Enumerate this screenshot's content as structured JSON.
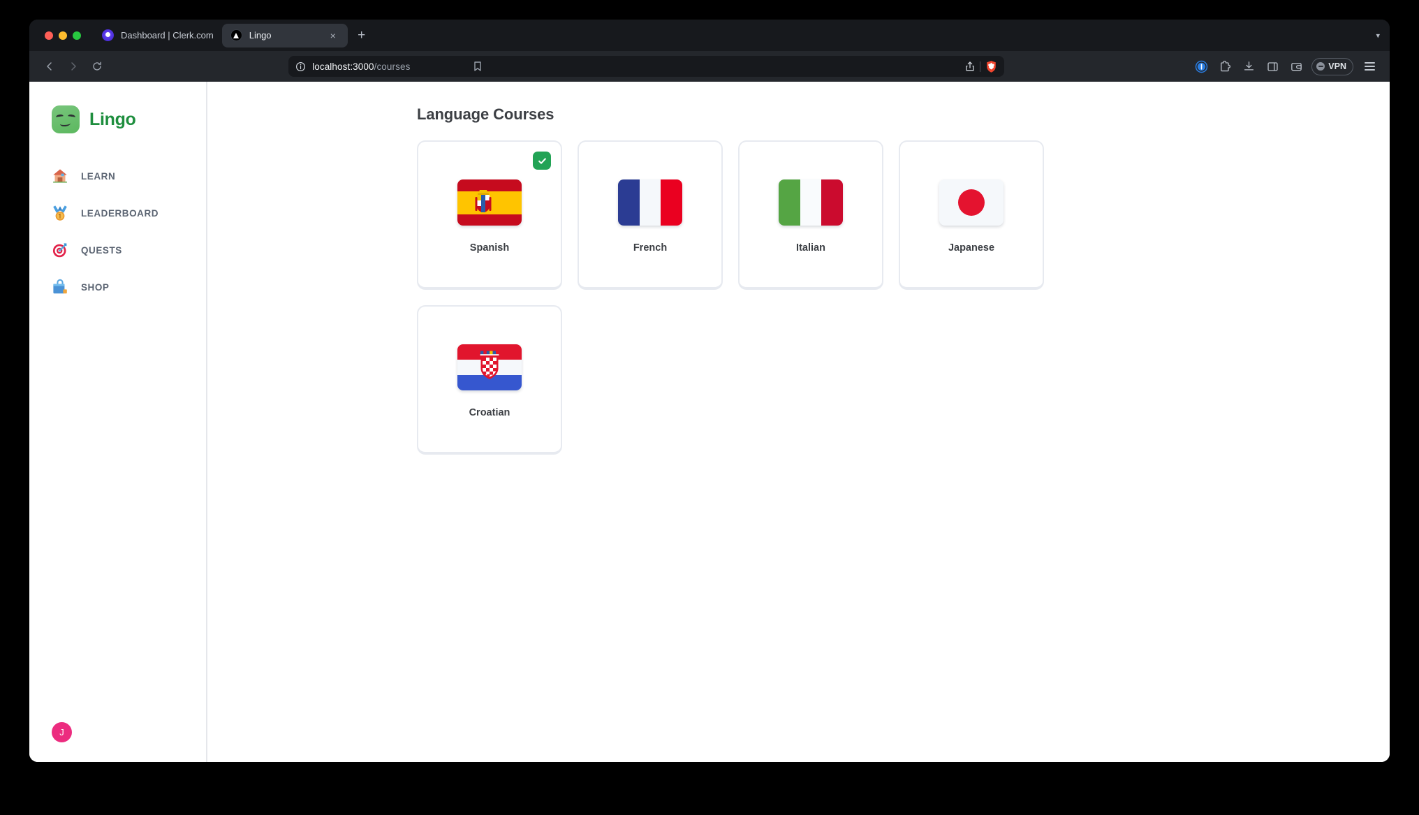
{
  "browser": {
    "name": "Brave",
    "tabs": [
      {
        "title": "Dashboard | Clerk.com",
        "favicon": "clerk-icon",
        "active": false
      },
      {
        "title": "Lingo",
        "favicon": "nextjs-triangle-icon",
        "active": true
      }
    ],
    "new_tab_label": "+",
    "tab_close_label": "×",
    "tabstrip_chevron": "▾",
    "url": {
      "host": "localhost:3000",
      "path": "/courses",
      "full": "localhost:3000/courses"
    },
    "toolbar": {
      "back_label": "back-icon",
      "forward_label": "forward-icon",
      "reload_label": "reload-icon",
      "bookmark_label": "bookmark-icon",
      "share_label": "share-icon",
      "shield_label": "brave-shields-icon",
      "actions": [
        {
          "name": "1password-extension-icon",
          "label": "1"
        },
        {
          "name": "extensions-icon",
          "label": ""
        },
        {
          "name": "downloads-icon",
          "label": ""
        },
        {
          "name": "sidebar-toggle-icon",
          "label": ""
        },
        {
          "name": "brave-wallet-icon",
          "label": ""
        }
      ],
      "vpn_label": "VPN",
      "menu_label": "menu-icon"
    }
  },
  "app": {
    "brand": {
      "name": "Lingo",
      "accent_color": "#1e8e3e",
      "mark": "lingo-mascot-icon"
    },
    "sidebar": {
      "items": [
        {
          "label": "LEARN",
          "icon": "house-icon"
        },
        {
          "label": "LEADERBOARD",
          "icon": "medal-icon"
        },
        {
          "label": "QUESTS",
          "icon": "target-dart-icon"
        },
        {
          "label": "SHOP",
          "icon": "shopping-bag-icon"
        }
      ],
      "user": {
        "initial": "J",
        "color": "#ec2c7f"
      }
    },
    "main": {
      "title": "Language Courses",
      "courses": [
        {
          "name": "Spanish",
          "flag": "flag-es",
          "selected": true
        },
        {
          "name": "French",
          "flag": "flag-fr",
          "selected": false
        },
        {
          "name": "Italian",
          "flag": "flag-it",
          "selected": false
        },
        {
          "name": "Japanese",
          "flag": "flag-jp",
          "selected": false
        },
        {
          "name": "Croatian",
          "flag": "flag-hr",
          "selected": false
        }
      ],
      "selected_badge": "check-icon",
      "selected_badge_color": "#22a355"
    }
  }
}
